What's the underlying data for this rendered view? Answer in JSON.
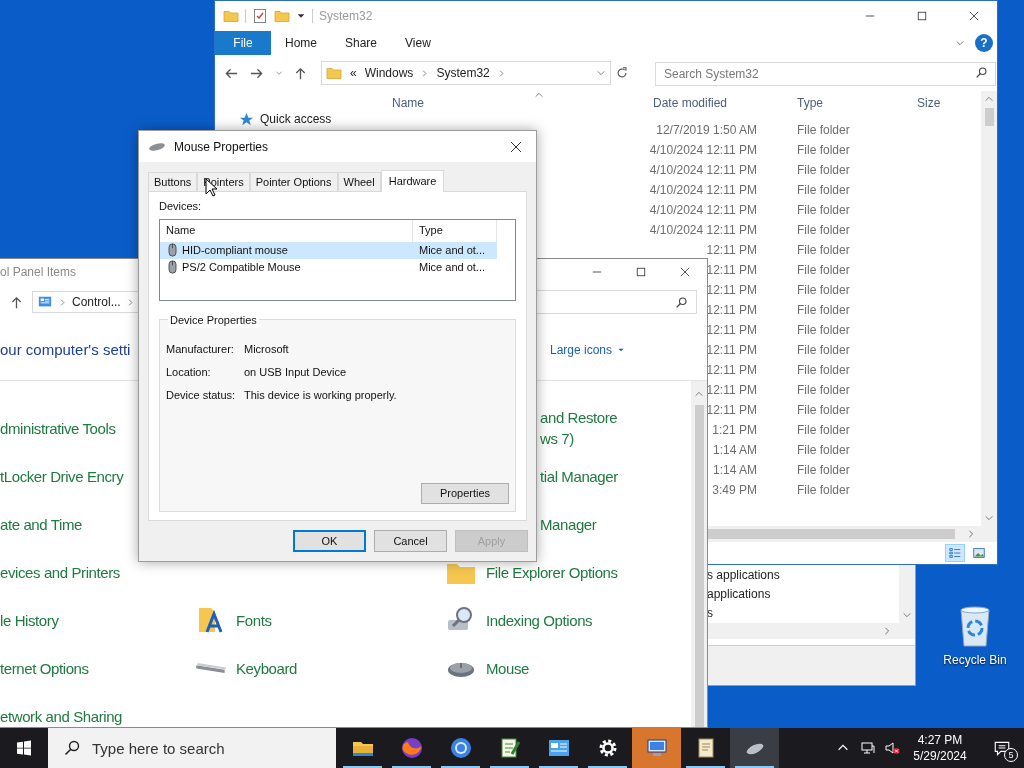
{
  "explorer": {
    "title": "System32",
    "file_menu": "File",
    "ribbon_tabs": [
      "Home",
      "Share",
      "View"
    ],
    "help": "?",
    "address": {
      "overflow": "«",
      "path": [
        "Windows",
        "System32"
      ]
    },
    "search": {
      "placeholder": "Search System32"
    },
    "nav": [
      "Quick access"
    ],
    "columns": [
      "Name",
      "Date modified",
      "Type",
      "Size"
    ],
    "rows": [
      {
        "date": "12/7/2019 1:50 AM",
        "type": "File folder"
      },
      {
        "date": "4/10/2024 12:11 PM",
        "type": "File folder"
      },
      {
        "date": "4/10/2024 12:11 PM",
        "type": "File folder"
      },
      {
        "date": "4/10/2024 12:11 PM",
        "type": "File folder"
      },
      {
        "date": "4/10/2024 12:11 PM",
        "type": "File folder"
      },
      {
        "date": "4/10/2024 12:11 PM",
        "type": "File folder"
      },
      {
        "date": "12:11 PM",
        "type": "File folder"
      },
      {
        "date": "12:11 PM",
        "type": "File folder"
      },
      {
        "date": "12:11 PM",
        "type": "File folder"
      },
      {
        "date": "12:11 PM",
        "type": "File folder"
      },
      {
        "date": "12:11 PM",
        "type": "File folder"
      },
      {
        "date": "12:11 PM",
        "type": "File folder"
      },
      {
        "date": "12:11 PM",
        "type": "File folder"
      },
      {
        "date": "12:11 PM",
        "type": "File folder"
      },
      {
        "date": "12:11 PM",
        "type": "File folder"
      },
      {
        "date": "1:21 PM",
        "type": "File folder"
      },
      {
        "date": "1:14 AM",
        "type": "File folder"
      },
      {
        "date": "1:14 AM",
        "type": "File folder"
      },
      {
        "date": "3:49 PM",
        "type": "File folder"
      }
    ],
    "views": [
      {
        "selected": true
      },
      {
        "selected": false
      }
    ]
  },
  "background_window": {
    "rows": [
      "s applications",
      "applications",
      "s"
    ]
  },
  "control_panel": {
    "title": "ol Panel Items",
    "address": "Control...",
    "heading": "our computer's setti",
    "view_by": "Large icons",
    "rows": [
      {
        "left": {
          "kind": "text",
          "label": "dministrative Tools"
        },
        "right": {
          "kind": "text",
          "label": "and Restore ws 7)"
        }
      },
      {
        "left": {
          "kind": "text",
          "label": "tLocker Drive Encry"
        },
        "right": {
          "kind": "text",
          "label": "tial Manager"
        }
      },
      {
        "left": {
          "kind": "text",
          "label": "ate and Time"
        },
        "right": {
          "kind": "text",
          "label": "Manager"
        }
      },
      {
        "left": {
          "kind": "text",
          "label": "evices and Printers"
        },
        "right": {
          "kind": "icon",
          "label": "File Explorer Options"
        }
      },
      {
        "left": {
          "kind": "text",
          "label": "le History"
        },
        "middle": {
          "kind": "icon",
          "label": "Fonts"
        },
        "right": {
          "kind": "icon",
          "label": "Indexing Options"
        }
      },
      {
        "left": {
          "kind": "text",
          "label": "ternet Options"
        },
        "middle": {
          "kind": "icon",
          "label": "Keyboard"
        },
        "right": {
          "kind": "icon",
          "label": "Mouse"
        }
      },
      {
        "left": {
          "kind": "text",
          "label": "etwork and Sharing"
        }
      }
    ]
  },
  "mouse_properties": {
    "title": "Mouse Properties",
    "tabs": [
      {
        "label": "Buttons",
        "selected": false
      },
      {
        "label": "Pointers",
        "selected": false
      },
      {
        "label": "Pointer Options",
        "selected": false
      },
      {
        "label": "Wheel",
        "selected": false
      },
      {
        "label": "Hardware",
        "selected": true
      }
    ],
    "devices_label": "Devices:",
    "device_columns": [
      "Name",
      "Type"
    ],
    "devices": [
      {
        "name": "HID-compliant mouse",
        "type": "Mice and ot...",
        "selected": true
      },
      {
        "name": "PS/2 Compatible Mouse",
        "type": "Mice and ot...",
        "selected": false
      }
    ],
    "group_title": "Device Properties",
    "fields": [
      {
        "label": "Manufacturer:",
        "value": "Microsoft"
      },
      {
        "label": "Location:",
        "value": "on USB Input Device"
      },
      {
        "label": "Device status:",
        "value": "This device is working properly."
      }
    ],
    "properties_button": "Properties",
    "buttons": [
      {
        "label": "OK",
        "default": true,
        "disabled": false
      },
      {
        "label": "Cancel",
        "default": false,
        "disabled": false
      },
      {
        "label": "Apply",
        "default": false,
        "disabled": true
      }
    ]
  },
  "desktop": {
    "icons": [
      {
        "label": "Recycle Bin"
      }
    ]
  },
  "taskbar": {
    "search": {
      "placeholder": "Type here to search"
    },
    "apps": [
      {
        "running": true,
        "active": false,
        "alert": false
      },
      {
        "running": true,
        "active": false,
        "alert": false
      },
      {
        "running": true,
        "active": false,
        "alert": false
      },
      {
        "running": true,
        "active": false,
        "alert": false
      },
      {
        "running": true,
        "active": false,
        "alert": false
      },
      {
        "running": true,
        "active": false,
        "alert": false
      },
      {
        "running": false,
        "active": false,
        "alert": true
      },
      {
        "running": true,
        "active": false,
        "alert": false
      },
      {
        "running": true,
        "active": true,
        "alert": false
      }
    ],
    "time": "4:27 PM",
    "date": "5/29/2024",
    "notifications": "5"
  }
}
